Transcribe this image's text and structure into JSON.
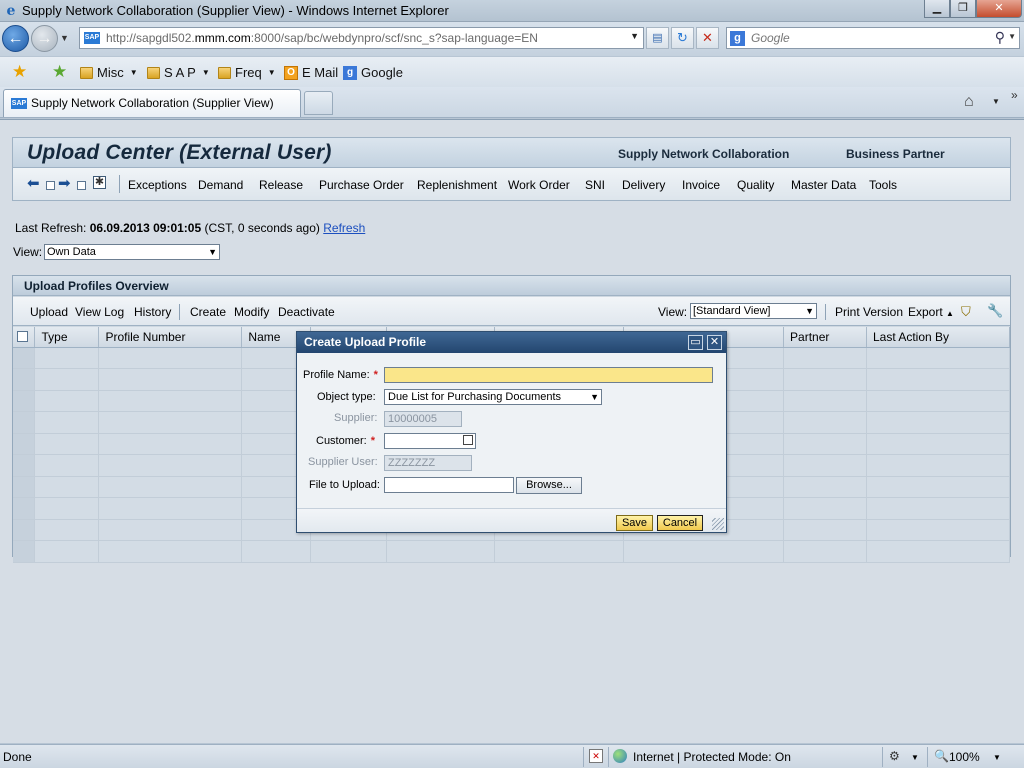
{
  "browser": {
    "window_title": "Supply Network Collaboration (Supplier View) - Windows Internet Explorer",
    "url_gray": "http://sapgdl502.",
    "url_domain": "mmm.com",
    "url_rest": ":8000/sap/bc/webdynpro/scf/snc_s?sap-language=EN",
    "search_placeholder": "Google",
    "favorites": [
      {
        "label": "Misc"
      },
      {
        "label": "S A P"
      },
      {
        "label": "Freq"
      },
      {
        "label": "E Mail"
      },
      {
        "label": "Google"
      }
    ],
    "active_tab_title": "Supply Network Collaboration (Supplier View)",
    "sap_icon_text": "SAP"
  },
  "page": {
    "title": "Upload Center (External User)",
    "app_name": "Supply Network Collaboration",
    "business_partner": "Business Partner",
    "menu": [
      "Exceptions",
      "Demand",
      "Release",
      "Purchase Order",
      "Replenishment",
      "Work Order",
      "SNI",
      "Delivery",
      "Invoice",
      "Quality",
      "Master Data",
      "Tools"
    ],
    "last_refresh_label": "Last Refresh:",
    "last_refresh_value": "06.09.2013 09:01:05",
    "last_refresh_suffix": "(CST, 0 seconds ago)",
    "refresh_link": "Refresh",
    "view_label": "View:",
    "view_value": "Own Data"
  },
  "overview": {
    "title": "Upload Profiles Overview",
    "toolbar": {
      "upload": "Upload",
      "view_log": "View Log",
      "history": "History",
      "create": "Create",
      "modify": "Modify",
      "deactivate": "Deactivate",
      "view_label": "View:",
      "view_value": "[Standard View]",
      "print_version": "Print Version",
      "export": "Export"
    },
    "columns": [
      "Type",
      "Profile Number",
      "Name",
      "",
      "",
      "",
      "Partner",
      "Last Action By"
    ]
  },
  "dialog": {
    "title": "Create Upload Profile",
    "profile_name_label": "Profile Name:",
    "profile_name_value": "",
    "object_type_label": "Object type:",
    "object_type_value": "Due List for Purchasing Documents",
    "supplier_label": "Supplier:",
    "supplier_value": "10000005",
    "customer_label": "Customer:",
    "customer_value": "",
    "supplier_user_label": "Supplier User:",
    "supplier_user_value": "ZZZZZZZ",
    "file_label": "File to Upload:",
    "file_value": "",
    "browse_label": "Browse...",
    "save_label": "Save",
    "cancel_label": "Cancel",
    "required_marker": "*"
  },
  "status": {
    "left": "Done",
    "zone": "Internet | Protected Mode: On",
    "zoom": "100%"
  },
  "colors": {
    "dialog_title_bg": "#23466f",
    "required_field_bg": "#fae68a",
    "link": "#1c4fbf",
    "button_bg": "#f1c94d"
  }
}
